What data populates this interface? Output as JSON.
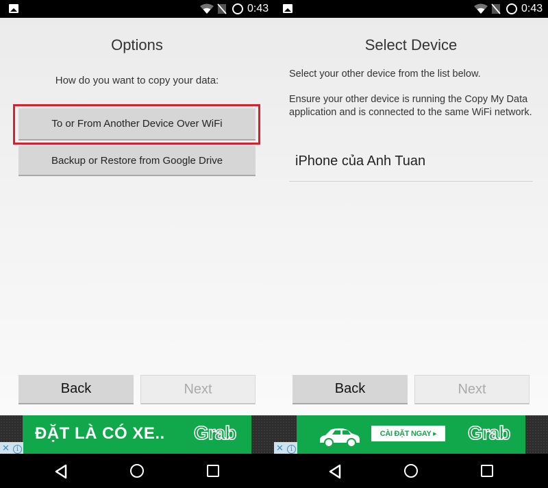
{
  "status_bar": {
    "time": "0:43",
    "icons": [
      "gallery-notification-icon",
      "wifi-icon",
      "no-sim-icon",
      "battery-charging-icon"
    ]
  },
  "screens": [
    {
      "title": "Options",
      "subtitle": "How do you want to copy your data:",
      "options": [
        {
          "label": "To or From Another Device Over WiFi",
          "highlighted": true
        },
        {
          "label": "Backup or Restore from Google Drive",
          "highlighted": false
        }
      ],
      "back_label": "Back",
      "next_label": "Next",
      "next_enabled": false,
      "ad": {
        "text": "ĐẶT LÀ CÓ XE..",
        "brand": "Grab"
      }
    },
    {
      "title": "Select Device",
      "instruction": "Select your other device from the list below.",
      "note": "Ensure your other device is running the Copy My Data application and is connected to the same WiFi network.",
      "devices": [
        {
          "name": "iPhone của Anh Tuan"
        }
      ],
      "back_label": "Back",
      "next_label": "Next",
      "next_enabled": false,
      "ad": {
        "cta": "CÀI ĐẶT NGAY ▸",
        "brand": "Grab"
      }
    }
  ],
  "ad_controls": {
    "close": "✕",
    "info": "i"
  },
  "colors": {
    "highlight": "#d8202a",
    "ad_green": "#10a84a",
    "button_gray": "#d6d6d6",
    "disabled_text": "#aaaaaa"
  }
}
